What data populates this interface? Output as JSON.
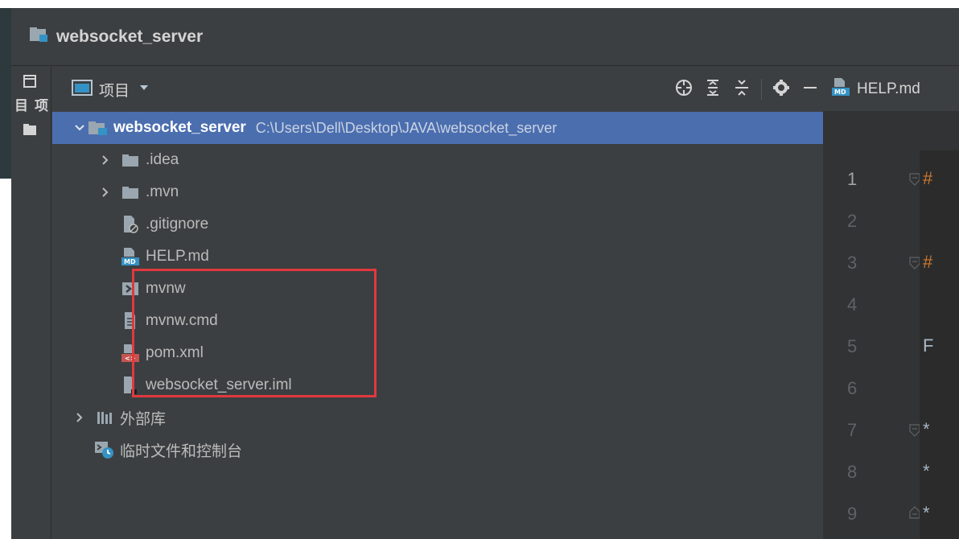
{
  "window": {
    "title": "websocket_server"
  },
  "toolstrip": {
    "project_label": "项目"
  },
  "panel": {
    "view_label": "项目"
  },
  "tree": {
    "root": {
      "name": "websocket_server",
      "path": "C:\\Users\\Dell\\Desktop\\JAVA\\websocket_server"
    },
    "items": [
      {
        "name": ".idea",
        "icon": "folder-icon"
      },
      {
        "name": ".mvn",
        "icon": "folder-icon"
      },
      {
        "name": ".gitignore",
        "icon": "ignore-file-icon"
      },
      {
        "name": "HELP.md",
        "icon": "markdown-file-icon"
      },
      {
        "name": "mvnw",
        "icon": "shell-script-icon"
      },
      {
        "name": "mvnw.cmd",
        "icon": "text-file-icon"
      },
      {
        "name": "pom.xml",
        "icon": "maven-file-icon"
      },
      {
        "name": "websocket_server.iml",
        "icon": "module-file-icon"
      }
    ],
    "external_libraries": "外部库",
    "scratches": "临时文件和控制台"
  },
  "editor": {
    "tab_label": "HELP.md",
    "line_numbers": [
      "1",
      "2",
      "3",
      "4",
      "5",
      "6",
      "7",
      "8",
      "9"
    ],
    "code_chars": {
      "line1": "#",
      "line3": "#",
      "line5": "F",
      "line7": "*",
      "line8": "*",
      "line9": "*"
    }
  },
  "colors": {
    "selection": "#4b6eaf",
    "highlight_box": "#e0393e",
    "heading_hash": "#cc7832"
  }
}
